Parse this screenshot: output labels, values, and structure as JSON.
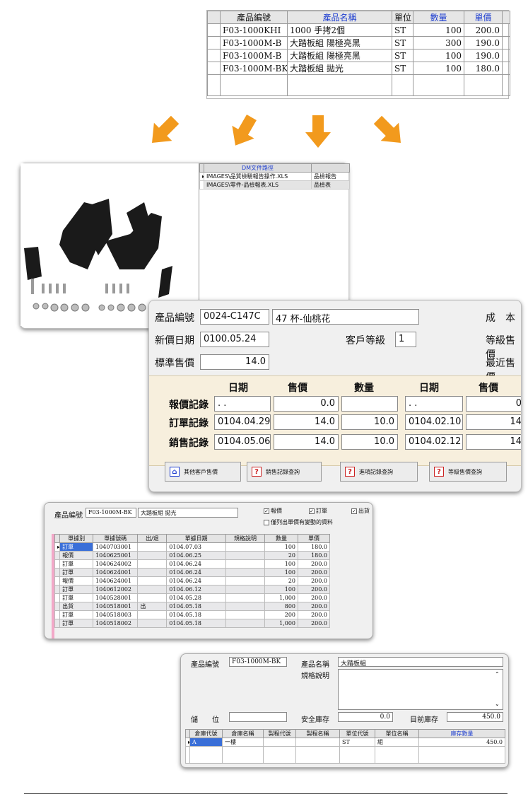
{
  "product_grid": {
    "columns": [
      "產品編號",
      "產品名稱",
      "單位",
      "數量",
      "單價"
    ],
    "rows": [
      [
        "F03-1000KHI",
        "1000 手拷2個",
        "ST",
        "100",
        "200.0"
      ],
      [
        "F03-1000M-B",
        "大踏板組 陽極亮黑",
        "ST",
        "300",
        "190.0"
      ],
      [
        "F03-1000M-B",
        "大踏板組 陽極亮黑",
        "ST",
        "100",
        "190.0"
      ],
      [
        "F03-1000M-BK",
        "大踏板組 拋光",
        "ST",
        "100",
        "180.0"
      ]
    ]
  },
  "dm_list": {
    "header": "DM文件路徑",
    "rows": [
      [
        "IMAGES\\品質檢驗報告操作.XLS",
        "品檢報告"
      ],
      [
        "IMAGES\\零件-品檢報表.XLS",
        "品檢表"
      ]
    ]
  },
  "price_form": {
    "product_no_label": "產品編號",
    "product_no": "0024-C147C",
    "product_name": "47 杯-仙桃花",
    "cost_label": "成　本",
    "new_price_date_label": "新價日期",
    "new_price_date": "0100.05.24",
    "customer_level_label": "客戶等級",
    "customer_level": "1",
    "level_price_label": "等級售價",
    "std_price_label": "標準售價",
    "std_price": "14.0",
    "recent_price_label": "最近售價",
    "col_date": "日期",
    "col_price": "售價",
    "col_qty": "數量",
    "col_date2": "日期",
    "col_price2": "售價",
    "records": [
      {
        "label": "報價記錄",
        "date": ". .",
        "price": "0.0",
        "qty": "",
        "date2": ". .",
        "price2": "0"
      },
      {
        "label": "訂單記錄",
        "date": "0104.04.29",
        "price": "14.0",
        "qty": "10.0",
        "date2": "0104.02.10",
        "price2": "14"
      },
      {
        "label": "銷售記錄",
        "date": "0104.05.06",
        "price": "14.0",
        "qty": "10.0",
        "date2": "0104.02.12",
        "price2": "14"
      }
    ],
    "buttons": [
      "其他客戶售價",
      "銷售記錄查詢",
      "進項記錄查詢",
      "等級售價查詢"
    ]
  },
  "txn_query": {
    "product_no_label": "產品編號",
    "product_no": "F03-1000M-BK",
    "product_name": "大踏板組 拋光",
    "chk_quote": "報價",
    "chk_order": "訂單",
    "chk_ship": "出貨",
    "chk_changed": "僅列出單價有變動的資料",
    "columns": [
      "單據別",
      "單據號碼",
      "出/退",
      "單據日期",
      "規格說明",
      "數量",
      "單價"
    ],
    "rows": [
      [
        "訂單",
        "1040703001",
        "",
        "0104.07.03",
        "",
        "100",
        "180.0"
      ],
      [
        "報價",
        "1040625001",
        "",
        "0104.06.25",
        "",
        "20",
        "180.0"
      ],
      [
        "訂單",
        "1040624002",
        "",
        "0104.06.24",
        "",
        "100",
        "200.0"
      ],
      [
        "訂單",
        "1040624001",
        "",
        "0104.06.24",
        "",
        "100",
        "200.0"
      ],
      [
        "報價",
        "1040624001",
        "",
        "0104.06.24",
        "",
        "20",
        "200.0"
      ],
      [
        "訂單",
        "1040612002",
        "",
        "0104.06.12",
        "",
        "100",
        "200.0"
      ],
      [
        "訂單",
        "1040528001",
        "",
        "0104.05.28",
        "",
        "1,000",
        "200.0"
      ],
      [
        "出貨",
        "1040518001",
        "出",
        "0104.05.18",
        "",
        "800",
        "200.0"
      ],
      [
        "訂單",
        "1040518003",
        "",
        "0104.05.18",
        "",
        "200",
        "200.0"
      ],
      [
        "訂單",
        "1040518002",
        "",
        "0104.05.18",
        "",
        "1,000",
        "200.0"
      ]
    ]
  },
  "inventory": {
    "product_no_label": "產品編號",
    "product_no": "F03-1000M-BK",
    "product_name_label": "產品名稱",
    "product_name": "大踏板組",
    "spec_label": "規格說明",
    "location_label": "儲　　位",
    "safety_label": "安全庫存",
    "safety_value": "0.0",
    "current_label": "目前庫存",
    "current_value": "450.0",
    "columns": [
      "倉庫代號",
      "倉庫名稱",
      "製程代號",
      "製程名稱",
      "單位代號",
      "單位名稱",
      "庫存數量"
    ],
    "rows": [
      [
        "A",
        "一樓",
        "",
        "",
        "ST",
        "組",
        "450.0"
      ]
    ]
  },
  "colors": {
    "arrow": "#f29a1d",
    "header_blue": "#1f3fd0",
    "record_bg": "#f7efdd"
  }
}
